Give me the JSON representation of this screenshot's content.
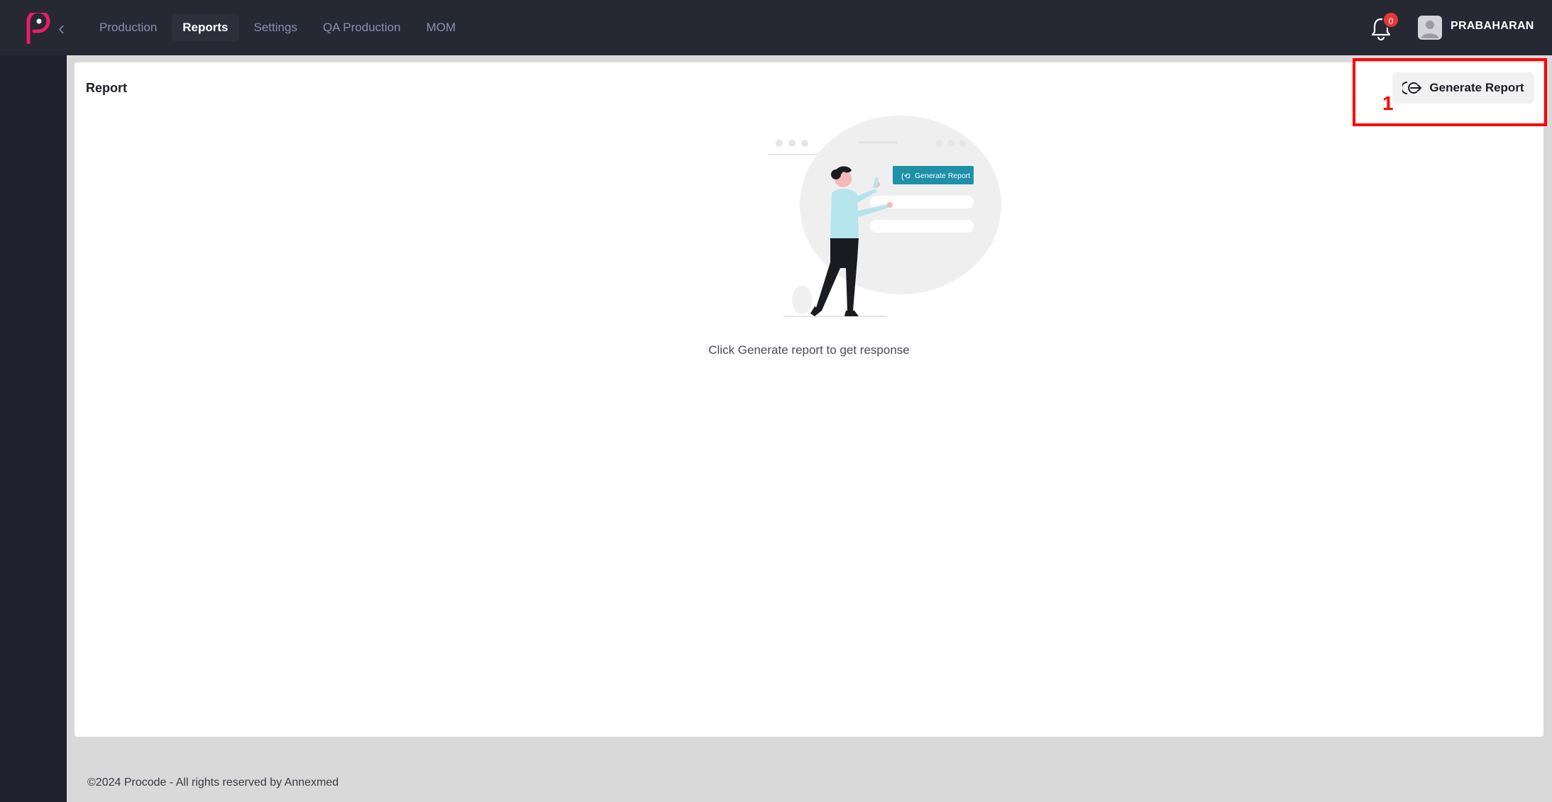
{
  "nav": {
    "items": [
      {
        "label": "Production",
        "active": false
      },
      {
        "label": "Reports",
        "active": true
      },
      {
        "label": "Settings",
        "active": false
      },
      {
        "label": "QA Production",
        "active": false
      },
      {
        "label": "MOM",
        "active": false
      }
    ]
  },
  "header": {
    "notification_count": "0",
    "username": "PRABAHARAN"
  },
  "report": {
    "title": "Report",
    "generate_label": "Generate Report",
    "illustration_button_label": "Generate Report",
    "empty_message": "Click Generate report to get response"
  },
  "annotation": {
    "number": "1"
  },
  "footer": {
    "text": "©2024 Procode - All rights reserved by Annexmed"
  },
  "colors": {
    "accent": "#e91e63",
    "topbar": "#262833",
    "sidebar": "#1f1f2e",
    "illustration_button": "#1e90a8",
    "badge": "#e5383b",
    "annotation": "#ff0000"
  }
}
